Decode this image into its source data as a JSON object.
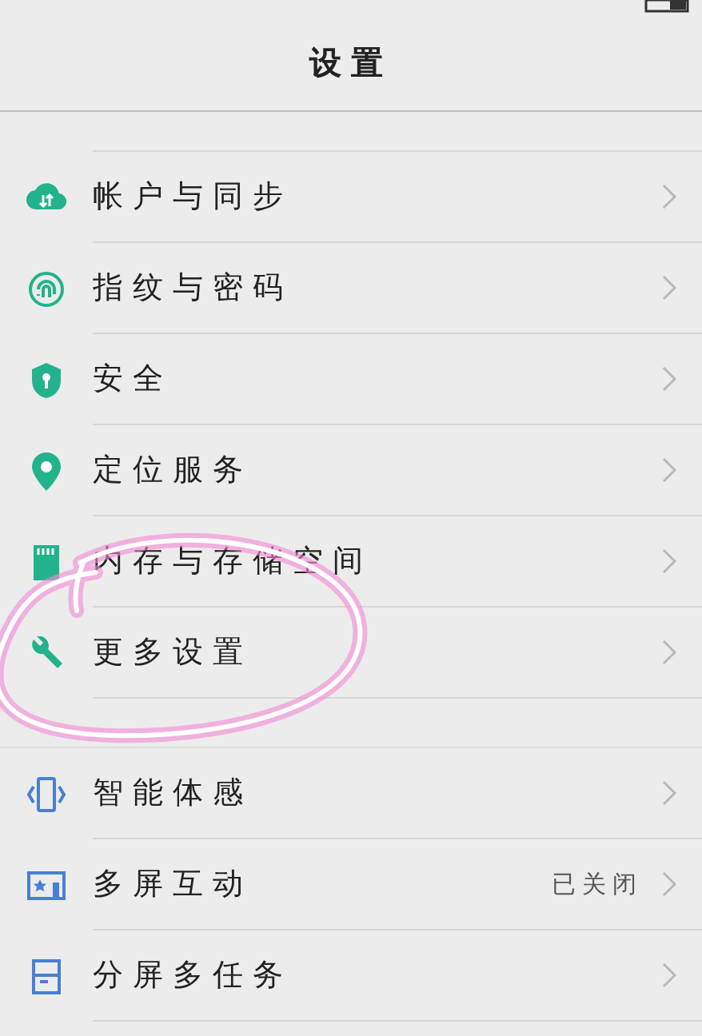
{
  "header": {
    "title": "设置"
  },
  "sections": [
    {
      "items": [
        {
          "label": "帐户与同步"
        },
        {
          "label": "指纹与密码"
        },
        {
          "label": "安全"
        },
        {
          "label": "定位服务"
        },
        {
          "label": "内存与存储空间"
        },
        {
          "label": "更多设置"
        }
      ]
    },
    {
      "items": [
        {
          "label": "智能体感"
        },
        {
          "label": "多屏互动",
          "value": "已关闭"
        },
        {
          "label": "分屏多任务"
        }
      ]
    }
  ]
}
